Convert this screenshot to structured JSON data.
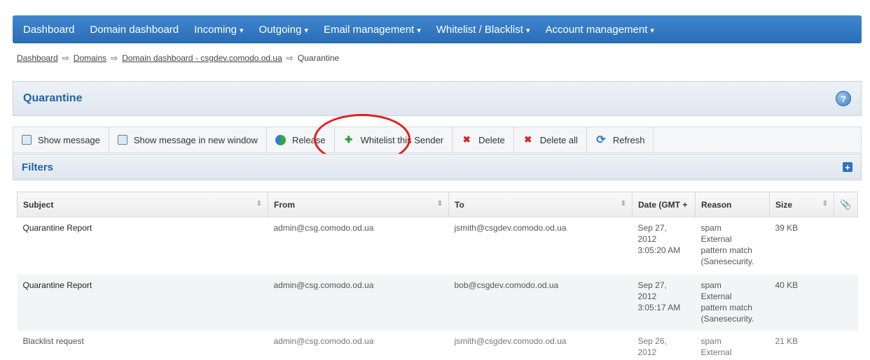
{
  "nav": {
    "items": [
      {
        "label": "Dashboard",
        "caret": ""
      },
      {
        "label": "Domain dashboard",
        "caret": ""
      },
      {
        "label": "Incoming",
        "caret": "▾"
      },
      {
        "label": "Outgoing",
        "caret": "▾"
      },
      {
        "label": "Email management",
        "caret": "▾"
      },
      {
        "label": "Whitelist / Blacklist",
        "caret": "▾"
      },
      {
        "label": "Account management",
        "caret": "▾"
      }
    ]
  },
  "breadcrumb": {
    "items": [
      "Dashboard",
      "Domains",
      "Domain dashboard - csgdev.comodo.od.ua"
    ],
    "current": "Quarantine",
    "separator": "⇨"
  },
  "page": {
    "title": "Quarantine",
    "help_glyph": "?"
  },
  "toolbar": {
    "show_message": "Show message",
    "show_message_new_window": "Show message in new window",
    "release": "Release",
    "whitelist_sender": "Whitelist this Sender",
    "delete": "Delete",
    "delete_all": "Delete all",
    "refresh": "Refresh"
  },
  "filters": {
    "label": "Filters",
    "expand_glyph": "+"
  },
  "table": {
    "columns": {
      "subject": "Subject",
      "from": "From",
      "to": "To",
      "date": "Date (GMT +",
      "reason": "Reason",
      "size": "Size",
      "attachment": "📎"
    },
    "rows": [
      {
        "subject": "Quarantine Report",
        "from": "admin@csg.comodo.od.ua",
        "to": "jsmith@csgdev.comodo.od.ua",
        "date": [
          "Sep 27,",
          "2012",
          "3:05:20 AM"
        ],
        "reason": [
          "spam",
          "External",
          "pattern match",
          "(Sanesecurity."
        ],
        "size": "39 KB"
      },
      {
        "subject": "Quarantine Report",
        "from": "admin@csg.comodo.od.ua",
        "to": "bob@csgdev.comodo.od.ua",
        "date": [
          "Sep 27,",
          "2012",
          "3:05:17 AM"
        ],
        "reason": [
          "spam",
          "External",
          "pattern match",
          "(Sanesecurity."
        ],
        "size": "40 KB"
      },
      {
        "subject": "Blacklist request",
        "from": "admin@csg.comodo.od.ua",
        "to": "jsmith@csgdev.comodo.od.ua",
        "date": [
          "Sep 26,",
          "2012"
        ],
        "reason": [
          "spam",
          "External"
        ],
        "size": "21 KB"
      }
    ]
  },
  "colors": {
    "nav_bg": "#2f76c2",
    "title": "#1f63a8",
    "highlight_circle": "#e51b1b"
  }
}
